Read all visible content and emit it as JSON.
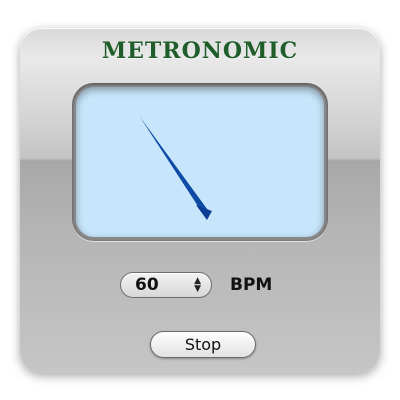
{
  "app": {
    "title": "METRONOMIC"
  },
  "tempo": {
    "value": "60",
    "unit": "BPM"
  },
  "controls": {
    "stop_label": "Stop"
  },
  "colors": {
    "title": "#1f5e2a",
    "screen": "#c8e6fb",
    "needle": "#0e4aa6"
  }
}
